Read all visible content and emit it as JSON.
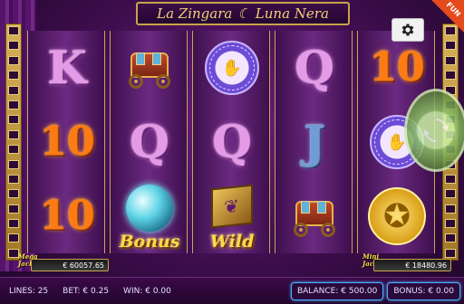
{
  "game": {
    "title_left": "La Zingara",
    "title_right": "Luna Nera",
    "corner_label": "FUN"
  },
  "reels": [
    [
      "K",
      "10",
      "10"
    ],
    [
      "wagon",
      "Q",
      "Bonus"
    ],
    [
      "zodiac",
      "Q",
      "Wild"
    ],
    [
      "Q",
      "J",
      "wagon"
    ],
    [
      "10",
      "zodiac",
      "coin"
    ]
  ],
  "symbols": {
    "K": "K",
    "Q": "Q",
    "J": "J",
    "ten": "10",
    "bonus": "Bonus",
    "wild": "Wild"
  },
  "jackpots": {
    "mega_label_1": "Mega",
    "mega_label_2": "Jackpot",
    "mega_value": "€ 60057.65",
    "mini_label_1": "Mini",
    "mini_label_2": "Jackpot",
    "mini_value": "€ 18480.96"
  },
  "status_bar": {
    "lines": "LINES: 25",
    "bet": "BET: € 0.25",
    "win": "WIN: € 0.00",
    "balance": "BALANCE: € 500.00",
    "bonus": "BONUS: € 0.00"
  },
  "icons": {
    "settings": "gear-icon",
    "spin": "spin-arrows-icon",
    "moon": "crescent-moon-icon"
  },
  "colors": {
    "background": "#3d0d4c",
    "reel": "#6b2a80",
    "gold": "#c9a34a",
    "accent_blue": "#4db0ff"
  }
}
